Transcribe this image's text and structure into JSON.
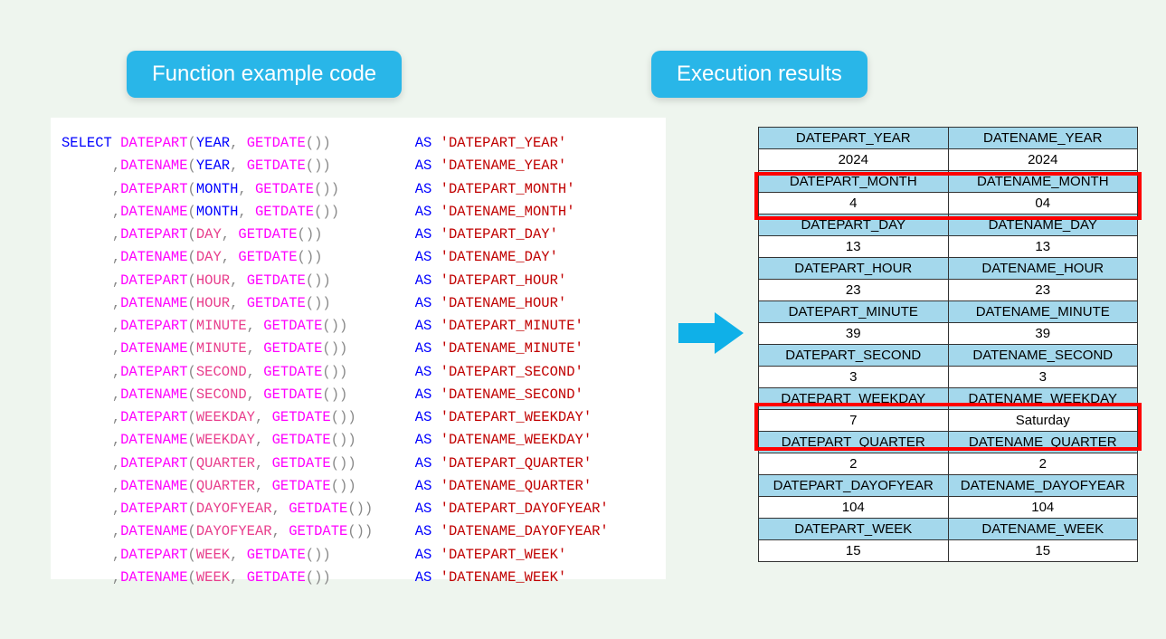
{
  "badges": {
    "left": "Function example code",
    "right": "Execution results"
  },
  "code": {
    "lines": [
      {
        "pre": "SELECT ",
        "fn": "DATEPART",
        "arg": "YEAR",
        "alias": "DATEPART_YEAR",
        "pad1": 10,
        "pad2": 4
      },
      {
        "pre": "      ,",
        "fn": "DATENAME",
        "arg": "YEAR",
        "alias": "DATENAME_YEAR",
        "pad1": 10,
        "pad2": 4
      },
      {
        "pre": "      ,",
        "fn": "DATEPART",
        "arg": "MONTH",
        "alias": "DATEPART_MONTH",
        "pad1": 10,
        "pad2": 3
      },
      {
        "pre": "      ,",
        "fn": "DATENAME",
        "arg": "MONTH",
        "alias": "DATENAME_MONTH",
        "pad1": 10,
        "pad2": 3
      },
      {
        "pre": "      ,",
        "fn": "DATEPART",
        "arg": "DAY",
        "alias": "DATEPART_DAY",
        "pad1": 10,
        "pad2": 5
      },
      {
        "pre": "      ,",
        "fn": "DATENAME",
        "arg": "DAY",
        "alias": "DATENAME_DAY",
        "pad1": 10,
        "pad2": 5
      },
      {
        "pre": "      ,",
        "fn": "DATEPART",
        "arg": "HOUR",
        "alias": "DATEPART_HOUR",
        "pad1": 10,
        "pad2": 4
      },
      {
        "pre": "      ,",
        "fn": "DATENAME",
        "arg": "HOUR",
        "alias": "DATENAME_HOUR",
        "pad1": 10,
        "pad2": 4
      },
      {
        "pre": "      ,",
        "fn": "DATEPART",
        "arg": "MINUTE",
        "alias": "DATEPART_MINUTE",
        "pad1": 10,
        "pad2": 2
      },
      {
        "pre": "      ,",
        "fn": "DATENAME",
        "arg": "MINUTE",
        "alias": "DATENAME_MINUTE",
        "pad1": 10,
        "pad2": 2
      },
      {
        "pre": "      ,",
        "fn": "DATEPART",
        "arg": "SECOND",
        "alias": "DATEPART_SECOND",
        "pad1": 10,
        "pad2": 2
      },
      {
        "pre": "      ,",
        "fn": "DATENAME",
        "arg": "SECOND",
        "alias": "DATENAME_SECOND",
        "pad1": 10,
        "pad2": 2
      },
      {
        "pre": "      ,",
        "fn": "DATEPART",
        "arg": "WEEKDAY",
        "alias": "DATEPART_WEEKDAY",
        "pad1": 10,
        "pad2": 1
      },
      {
        "pre": "      ,",
        "fn": "DATENAME",
        "arg": "WEEKDAY",
        "alias": "DATENAME_WEEKDAY",
        "pad1": 10,
        "pad2": 1
      },
      {
        "pre": "      ,",
        "fn": "DATEPART",
        "arg": "QUARTER",
        "alias": "DATEPART_QUARTER",
        "pad1": 10,
        "pad2": 1
      },
      {
        "pre": "      ,",
        "fn": "DATENAME",
        "arg": "QUARTER",
        "alias": "DATENAME_QUARTER",
        "pad1": 10,
        "pad2": 1
      },
      {
        "pre": "      ,",
        "fn": "DATEPART",
        "arg": "DAYOFYEAR",
        "alias": "DATEPART_DAYOFYEAR",
        "pad1": 8,
        "pad2": 0
      },
      {
        "pre": "      ,",
        "fn": "DATENAME",
        "arg": "DAYOFYEAR",
        "alias": "DATENAME_DAYOFYEAR",
        "pad1": 8,
        "pad2": 0
      },
      {
        "pre": "      ,",
        "fn": "DATEPART",
        "arg": "WEEK",
        "alias": "DATEPART_WEEK",
        "pad1": 10,
        "pad2": 4
      },
      {
        "pre": "      ,",
        "fn": "DATENAME",
        "arg": "WEEK",
        "alias": "DATENAME_WEEK",
        "pad1": 10,
        "pad2": 4
      }
    ],
    "getdate": "GETDATE",
    "as": "AS"
  },
  "results": [
    {
      "h1": "DATEPART_YEAR",
      "h2": "DATENAME_YEAR",
      "v1": "2024",
      "v2": "2024"
    },
    {
      "h1": "DATEPART_MONTH",
      "h2": "DATENAME_MONTH",
      "v1": "4",
      "v2": "04"
    },
    {
      "h1": "DATEPART_DAY",
      "h2": "DATENAME_DAY",
      "v1": "13",
      "v2": "13"
    },
    {
      "h1": "DATEPART_HOUR",
      "h2": "DATENAME_HOUR",
      "v1": "23",
      "v2": "23"
    },
    {
      "h1": "DATEPART_MINUTE",
      "h2": "DATENAME_MINUTE",
      "v1": "39",
      "v2": "39"
    },
    {
      "h1": "DATEPART_SECOND",
      "h2": "DATENAME_SECOND",
      "v1": "3",
      "v2": "3"
    },
    {
      "h1": "DATEPART_WEEKDAY",
      "h2": "DATENAME_WEEKDAY",
      "v1": "7",
      "v2": "Saturday"
    },
    {
      "h1": "DATEPART_QUARTER",
      "h2": "DATENAME_QUARTER",
      "v1": "2",
      "v2": "2"
    },
    {
      "h1": "DATEPART_DAYOFYEAR",
      "h2": "DATENAME_DAYOFYEAR",
      "v1": "104",
      "v2": "104"
    },
    {
      "h1": "DATEPART_WEEK",
      "h2": "DATENAME_WEEK",
      "v1": "15",
      "v2": "15"
    }
  ]
}
